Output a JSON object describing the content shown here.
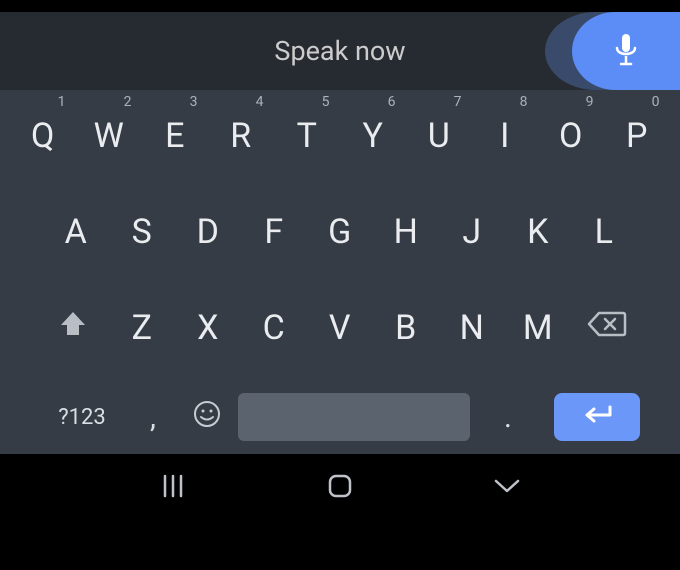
{
  "voice_bar": {
    "prompt": "Speak now"
  },
  "keyboard": {
    "row1": [
      {
        "letter": "Q",
        "num": "1"
      },
      {
        "letter": "W",
        "num": "2"
      },
      {
        "letter": "E",
        "num": "3"
      },
      {
        "letter": "R",
        "num": "4"
      },
      {
        "letter": "T",
        "num": "5"
      },
      {
        "letter": "Y",
        "num": "6"
      },
      {
        "letter": "U",
        "num": "7"
      },
      {
        "letter": "I",
        "num": "8"
      },
      {
        "letter": "O",
        "num": "9"
      },
      {
        "letter": "P",
        "num": "0"
      }
    ],
    "row2": [
      "A",
      "S",
      "D",
      "F",
      "G",
      "H",
      "J",
      "K",
      "L"
    ],
    "row3": [
      "Z",
      "X",
      "C",
      "V",
      "B",
      "N",
      "M"
    ],
    "fn_label": "?123",
    "comma": ",",
    "period": "."
  }
}
